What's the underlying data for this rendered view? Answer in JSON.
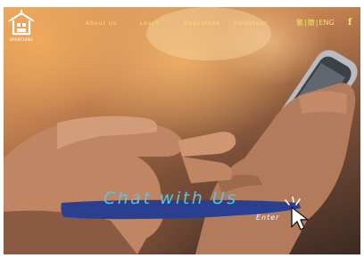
{
  "header": {
    "logo_text": "BRANCHING",
    "nav": [
      {
        "label": "About Us"
      },
      {
        "label": "Learn"
      },
      {
        "label": "Resources"
      },
      {
        "label": "Volunteer"
      }
    ],
    "languages": [
      "繁",
      "簡",
      "ENG"
    ],
    "facebook_label": "f",
    "accent_color": "#f4e36a"
  },
  "hero": {
    "chat_title": "Chat with Us",
    "enter_label": "Enter",
    "banner_color": "#2a3f8f",
    "title_color": "#59c3e6"
  },
  "icons": [
    "house-logo-icon",
    "facebook-icon",
    "pointer-cursor-icon"
  ]
}
